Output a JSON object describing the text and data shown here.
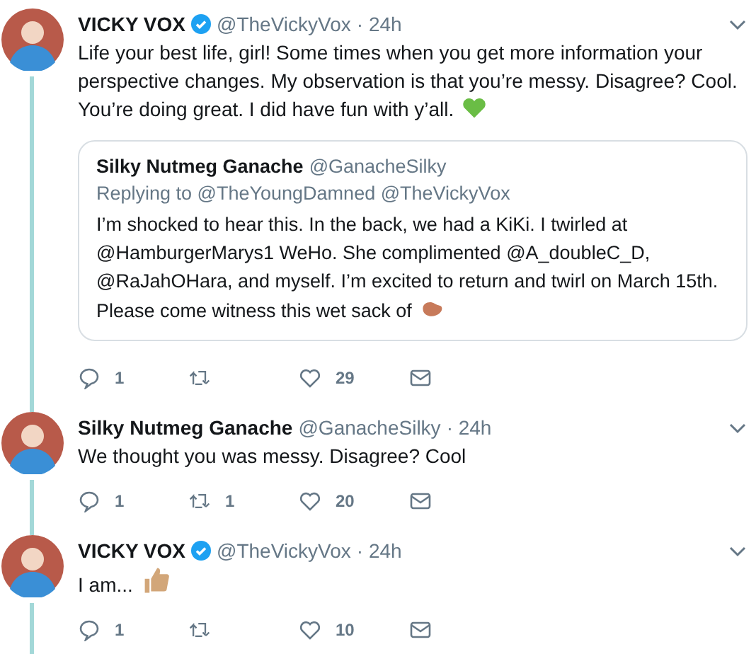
{
  "tweets": [
    {
      "name": "VICKY VOX",
      "verified": true,
      "handle": "@TheVickyVox",
      "time": "· 24h",
      "text": "Life your best life, girl! Some times when you get more information your perspective changes. My observation is that you’re messy. Disagree? Cool. You’re doing great. I did have fun with y’all.",
      "emoji": {
        "kind": "heart"
      },
      "thread_below": true,
      "quote": {
        "name": "Silky Nutmeg Ganache",
        "handle": "@GanacheSilky",
        "replying": "Replying to @TheYoungDamned @TheVickyVox",
        "text": "I’m shocked to hear this. In the back, we had a KiKi. I twirled at @HamburgerMarys1 WeHo. She complimented @A_doubleC_D, @RaJahOHara, and myself. I’m excited to return and twirl on March 15th. Please come witness this wet sack of",
        "emoji": {
          "kind": "bean"
        }
      },
      "actions": {
        "replies": "1",
        "likes": "29"
      }
    },
    {
      "name": "Silky Nutmeg Ganache",
      "verified": false,
      "handle": "@GanacheSilky",
      "time": "· 24h",
      "text": "We thought you was messy.  Disagree? Cool",
      "thread_below": true,
      "actions": {
        "replies": "1",
        "retweets": "1",
        "likes": "20"
      }
    },
    {
      "name": "VICKY VOX",
      "verified": true,
      "handle": "@TheVickyVox",
      "time": "· 24h",
      "text": "I am...",
      "emoji": {
        "kind": "thumbs-up"
      },
      "thread_below": true,
      "actions": {
        "replies": "1",
        "likes": "10"
      }
    }
  ]
}
